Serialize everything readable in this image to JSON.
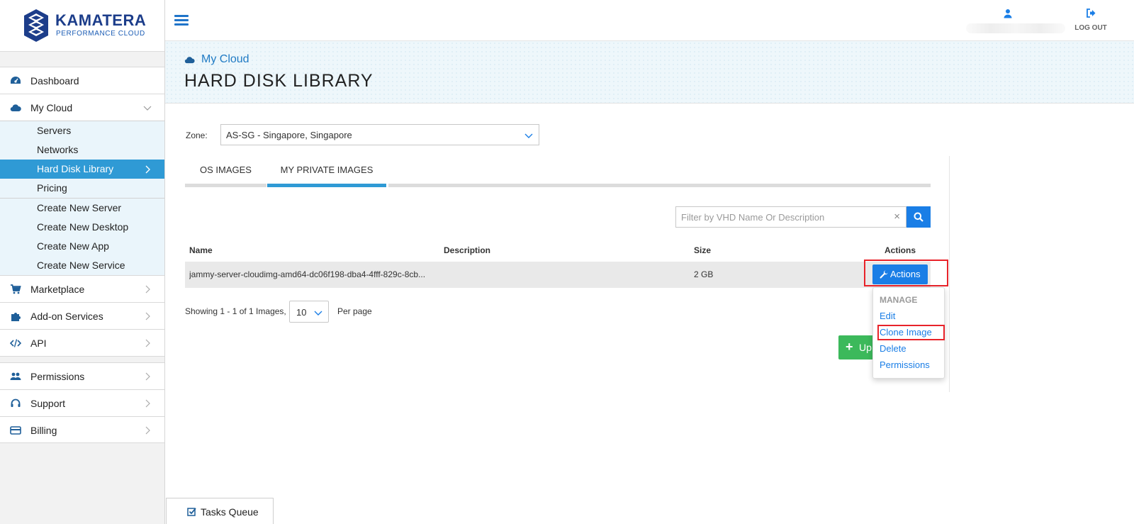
{
  "brand": {
    "name": "KAMATERA",
    "tagline": "PERFORMANCE CLOUD"
  },
  "sidebar": {
    "items": [
      {
        "label": "Dashboard",
        "icon": "dashboard-icon"
      },
      {
        "label": "My Cloud",
        "icon": "cloud-icon",
        "expanded": true
      },
      {
        "label": "Marketplace",
        "icon": "cart-icon"
      },
      {
        "label": "Add-on Services",
        "icon": "puzzle-icon"
      },
      {
        "label": "API",
        "icon": "code-icon"
      },
      {
        "label": "Permissions",
        "icon": "users-icon"
      },
      {
        "label": "Support",
        "icon": "headset-icon"
      },
      {
        "label": "Billing",
        "icon": "credit-card-icon"
      }
    ],
    "my_cloud_sub": [
      {
        "label": "Servers"
      },
      {
        "label": "Networks"
      },
      {
        "label": "Hard Disk Library",
        "active": true
      },
      {
        "label": "Pricing"
      }
    ],
    "create_sub": [
      {
        "label": "Create New Server"
      },
      {
        "label": "Create New Desktop"
      },
      {
        "label": "Create New App"
      },
      {
        "label": "Create New Service"
      }
    ]
  },
  "header": {
    "logout_label": "LOG OUT"
  },
  "page": {
    "breadcrumb": "My Cloud",
    "title": "HARD DISK LIBRARY"
  },
  "zone": {
    "label": "Zone:",
    "selected": "AS-SG - Singapore, Singapore"
  },
  "tabs": [
    {
      "label": "OS IMAGES",
      "active": false
    },
    {
      "label": "MY PRIVATE IMAGES",
      "active": true
    }
  ],
  "filter": {
    "placeholder": "Filter by VHD Name Or Description",
    "value": "",
    "clear": "×"
  },
  "table": {
    "columns": [
      "Name",
      "Description",
      "Size",
      "Actions"
    ],
    "rows": [
      {
        "name": "jammy-server-cloudimg-amd64-dc06f198-dba4-4fff-829c-8cb...",
        "description": "",
        "size": "2 GB",
        "action_label": "Actions"
      }
    ]
  },
  "pagination": {
    "showing": "Showing 1 - 1 of 1 Images,",
    "per_page_value": "10",
    "per_page_label": "Per page"
  },
  "upload_button": {
    "plus": "+",
    "label": "Up"
  },
  "actions_menu": {
    "header": "MANAGE",
    "items": [
      {
        "label": "Edit"
      },
      {
        "label": "Clone Image",
        "highlighted": true
      },
      {
        "label": "Delete"
      },
      {
        "label": "Permissions"
      }
    ]
  },
  "tasks_queue": {
    "label": "Tasks Queue"
  },
  "colors": {
    "accent": "#2f9ad5",
    "button": "#1a7ee6",
    "success": "#3cb95b",
    "highlight": "#e8232a",
    "brand": "#1c3d8a"
  }
}
